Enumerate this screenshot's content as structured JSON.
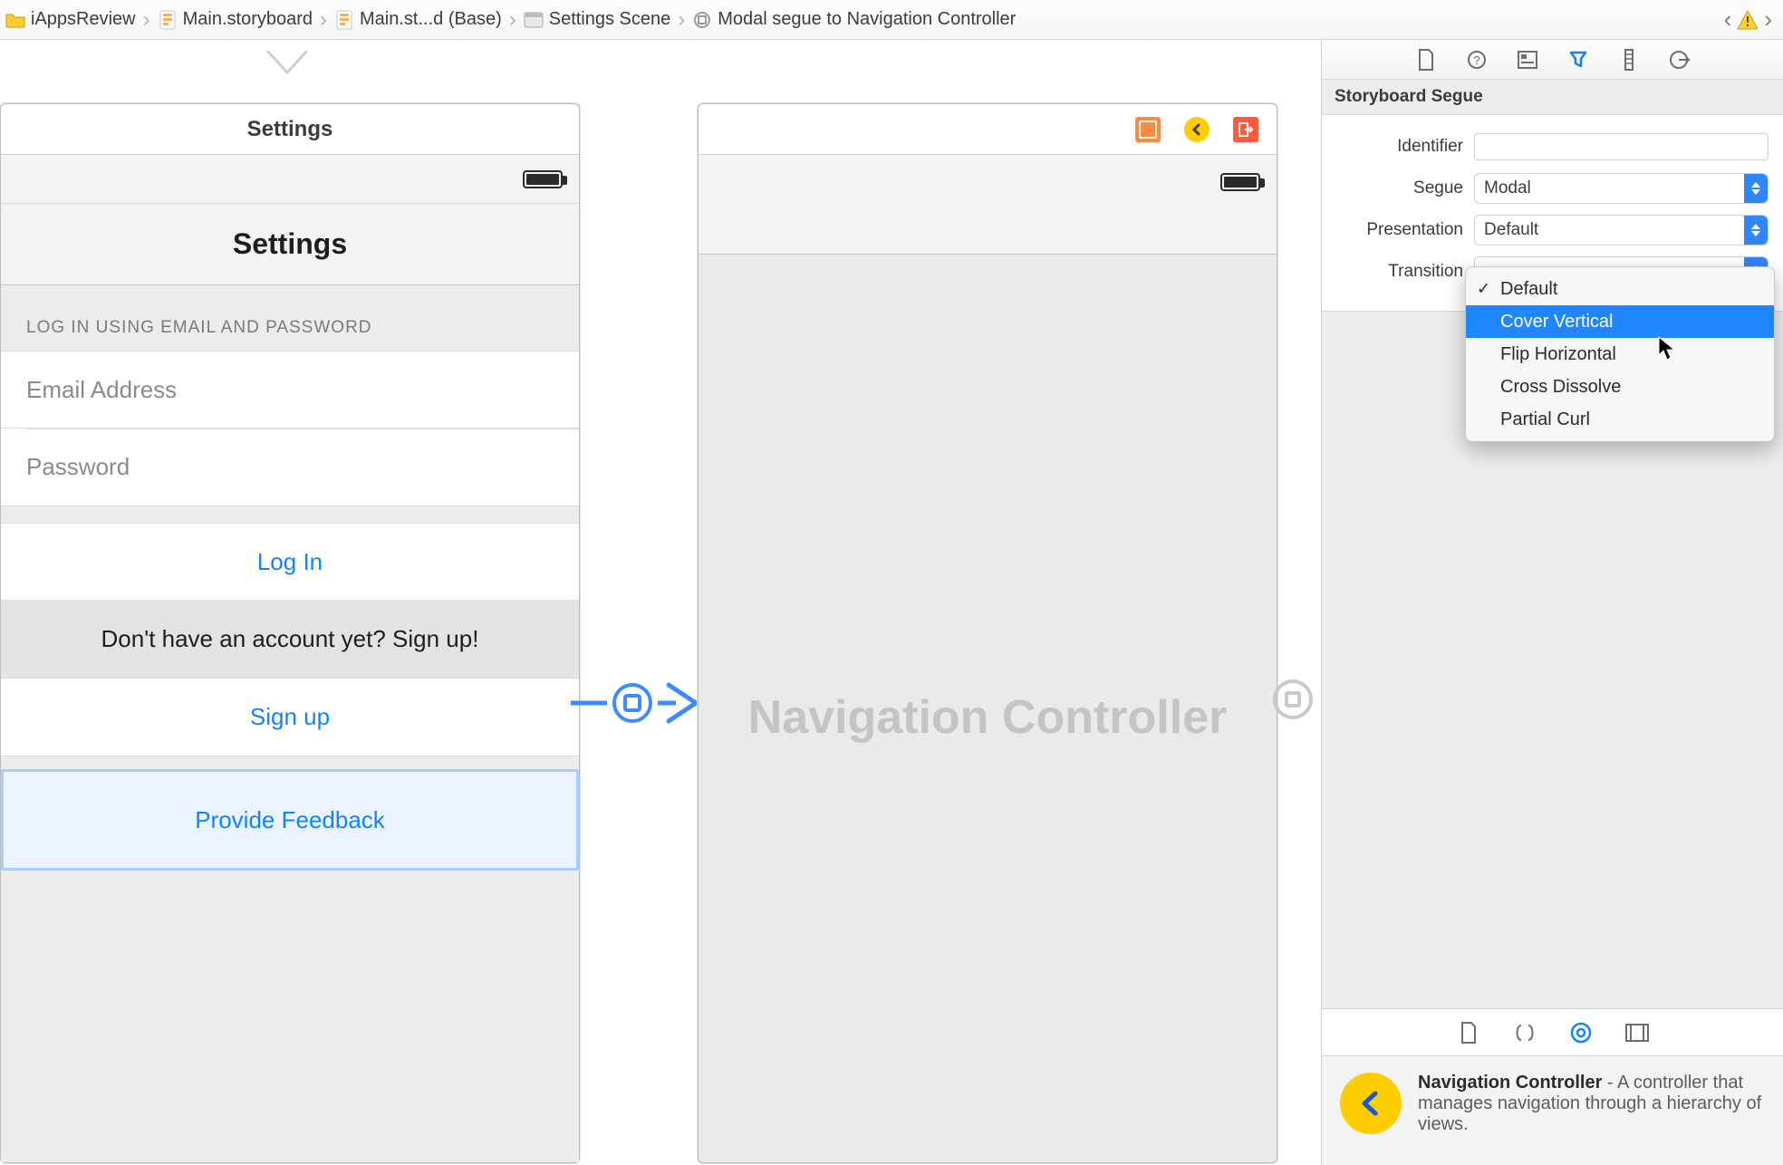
{
  "breadcrumbs": {
    "items": [
      {
        "label": "iAppsReview"
      },
      {
        "label": "Main.storyboard"
      },
      {
        "label": "Main.st...d (Base)"
      },
      {
        "label": "Settings Scene"
      },
      {
        "label": "Modal segue to Navigation Controller"
      }
    ]
  },
  "scenes": {
    "settings": {
      "scene_bar_title": "Settings",
      "nav_title": "Settings",
      "section_header": "LOG IN USING EMAIL AND PASSWORD",
      "email_placeholder": "Email Address",
      "password_placeholder": "Password",
      "login_button": "Log In",
      "signup_prompt": "Don't have an account yet? Sign up!",
      "signup_button": "Sign up",
      "feedback_button": "Provide Feedback"
    },
    "nav": {
      "watermark": "Navigation Controller"
    }
  },
  "inspector": {
    "header": "Storyboard Segue",
    "labels": {
      "identifier": "Identifier",
      "segue": "Segue",
      "presentation": "Presentation",
      "transition": "Transition"
    },
    "values": {
      "identifier": "",
      "segue": "Modal",
      "presentation": "Default"
    },
    "transition_menu": {
      "checked": "Default",
      "highlighted": "Cover Vertical",
      "items": [
        "Default",
        "Cover Vertical",
        "Flip Horizontal",
        "Cross Dissolve",
        "Partial Curl"
      ]
    }
  },
  "library": {
    "title": "Navigation Controller",
    "suffix": " - A controller that manages navigation through a hierarchy of views."
  }
}
